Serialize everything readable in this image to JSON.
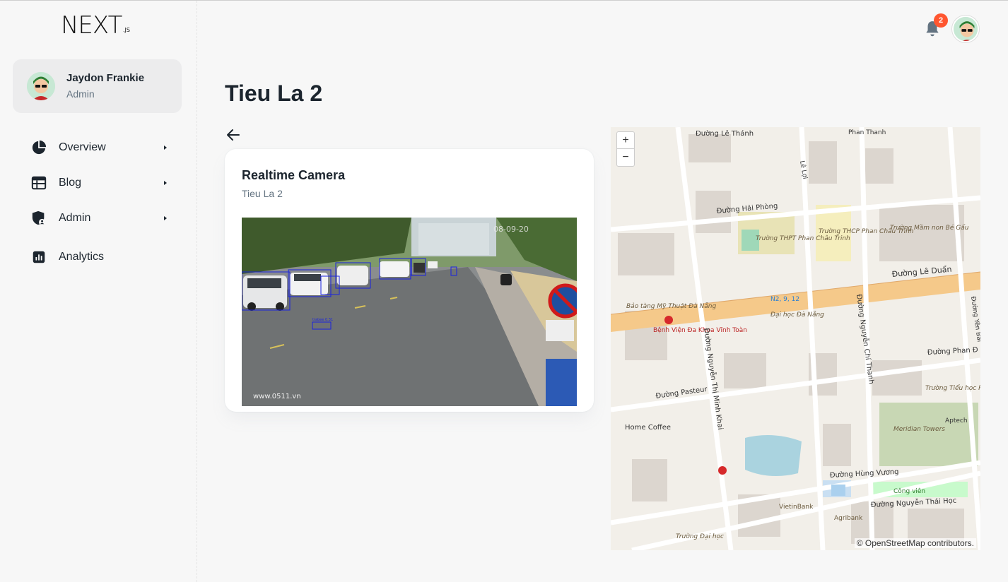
{
  "sidebar": {
    "logo_text": "NEXT.JS",
    "user": {
      "name": "Jaydon Frankie",
      "role": "Admin"
    },
    "nav": [
      {
        "label": "Overview",
        "icon": "pie-chart-icon",
        "has_submenu": true
      },
      {
        "label": "Blog",
        "icon": "blog-table-icon",
        "has_submenu": true
      },
      {
        "label": "Admin",
        "icon": "shield-user-icon",
        "has_submenu": true
      },
      {
        "label": "Analytics",
        "icon": "analytics-icon",
        "has_submenu": false
      }
    ]
  },
  "header": {
    "notification_count": "2"
  },
  "page": {
    "title": "Tieu La 2"
  },
  "camera_card": {
    "title": "Realtime Camera",
    "subtitle": "Tieu La 2",
    "overlay_timestamp": "08-09-20",
    "watermark": "www.0511.vn",
    "detection_label": "trabee 0.31"
  },
  "map": {
    "attribution": "© OpenStreetMap contributors.",
    "zoom_in": "+",
    "zoom_out": "−",
    "labels": [
      "Đường Lê Thánh",
      "Phan Thanh",
      "Đường Hải Phòng",
      "Trường THPT Phan Châu Trinh",
      "Trường THCP Phan Châu Trinh",
      "Trường Mầm non Bé Gấu",
      "Đường Lê Duẩn",
      "Bảo tàng Mỹ Thuật Đà Nẵng",
      "Bệnh Viện Đa Khoa Vĩnh Toàn",
      "Đại học Đà Nẵng",
      "N2, 9, 12",
      "Đường Nguyễn Thị Minh Khai",
      "Đường Nguyễn Chí Thanh",
      "Đường Phan Đ",
      "Đường Pasteur",
      "Trường Tiểu học Phù Đổng",
      "Aptech",
      "Home Coffee",
      "Meridian Towers",
      "Đường Hùng Vương",
      "Công viên",
      "Đường Nguyễn Thái Học",
      "VietinBank",
      "Agribank",
      "Trường Đại học",
      "Lê Lợi",
      "Đường Yên Bái"
    ]
  },
  "colors": {
    "accent": "#ff5630",
    "road_major": "#f5c98a",
    "water": "#aad3df",
    "park": "#c8facc"
  }
}
